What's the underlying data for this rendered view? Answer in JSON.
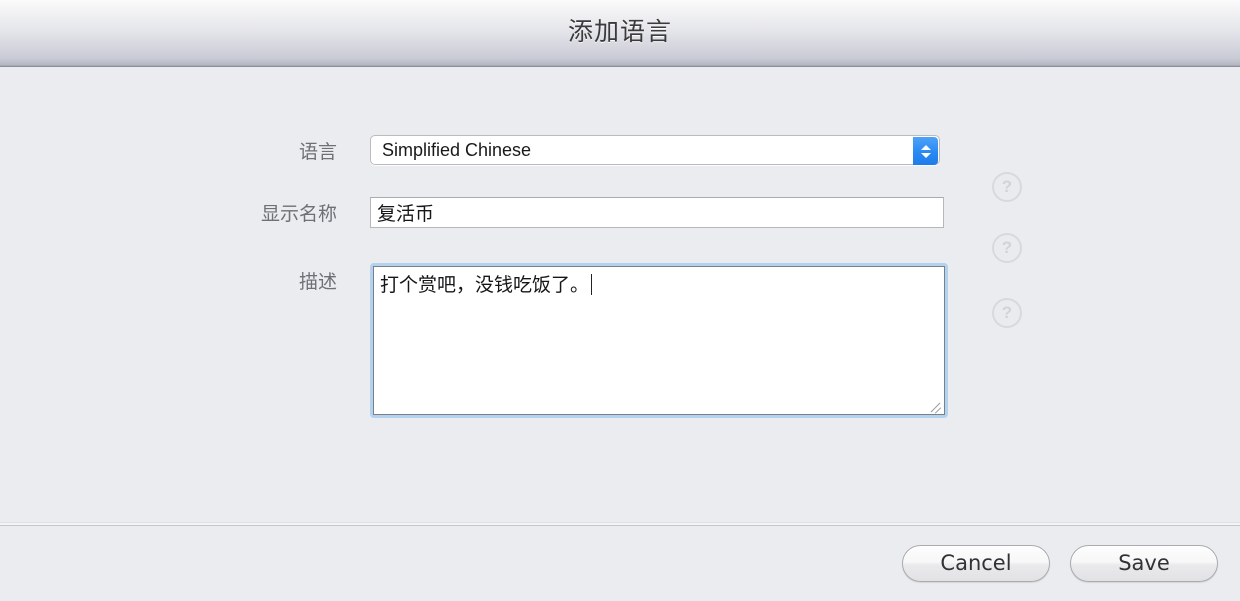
{
  "window": {
    "title": "添加语言"
  },
  "form": {
    "language": {
      "label": "语言",
      "selected_option": "Simplified Chinese",
      "options": [
        "Simplified Chinese"
      ],
      "help_glyph": "?"
    },
    "display_name": {
      "label": "显示名称",
      "value": "复活币",
      "placeholder": "",
      "help_glyph": "?"
    },
    "description": {
      "label": "描述",
      "value": "打个赏吧，没钱吃饭了。",
      "placeholder": "",
      "help_glyph": "?"
    }
  },
  "footer": {
    "cancel_label": "Cancel",
    "save_label": "Save"
  },
  "colors": {
    "accent_blue": "#2b8af3",
    "focus_ring": "#b2d2f0",
    "window_background": "#ebecef",
    "label_text": "#6e7076",
    "title_text": "#3b3b3d"
  }
}
